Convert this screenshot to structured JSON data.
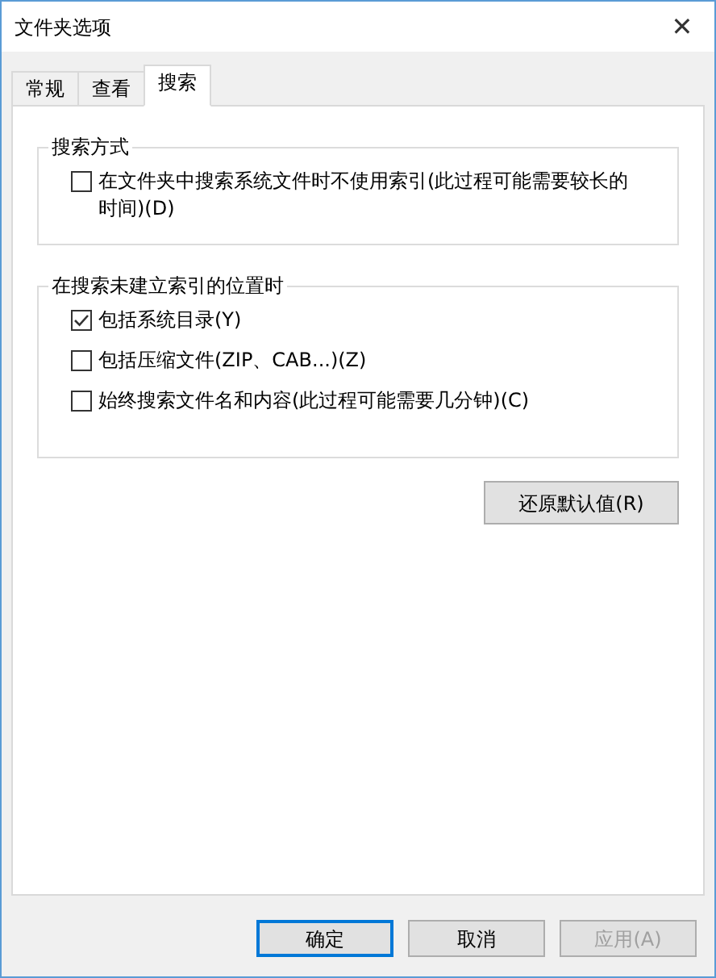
{
  "window": {
    "title": "文件夹选项",
    "close": "✕"
  },
  "tabs": [
    {
      "label": "常规",
      "selected": false
    },
    {
      "label": "查看",
      "selected": false
    },
    {
      "label": "搜索",
      "selected": true
    }
  ],
  "groups": [
    {
      "title": "搜索方式",
      "options": [
        {
          "label": "在文件夹中搜索系统文件时不使用索引(此过程可能需要较长的时间)(D)",
          "checked": false
        }
      ]
    },
    {
      "title": "在搜索未建立索引的位置时",
      "options": [
        {
          "label": "包括系统目录(Y)",
          "checked": true
        },
        {
          "label": "包括压缩文件(ZIP、CAB...)(Z)",
          "checked": false
        },
        {
          "label": "始终搜索文件名和内容(此过程可能需要几分钟)(C)",
          "checked": false
        }
      ]
    }
  ],
  "restore_button": "还原默认值(R)",
  "buttons": [
    {
      "label": "确定",
      "default": true,
      "disabled": false
    },
    {
      "label": "取消",
      "default": false,
      "disabled": false
    },
    {
      "label": "应用(A)",
      "default": false,
      "disabled": true
    }
  ]
}
